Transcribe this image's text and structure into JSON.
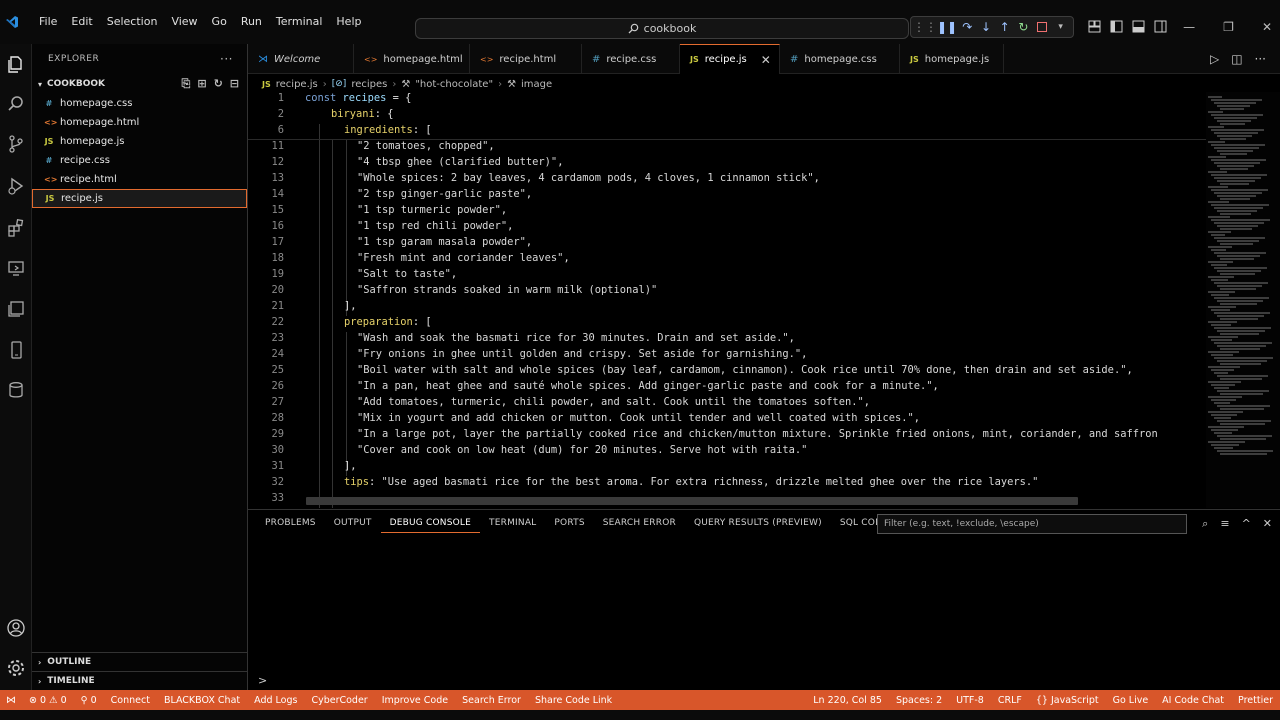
{
  "titlebar": {
    "menu": [
      "File",
      "Edit",
      "Selection",
      "View",
      "Go",
      "Run",
      "Terminal",
      "Help"
    ],
    "search_text": "cookbook"
  },
  "sidebar": {
    "header": "EXPLORER",
    "folder": "COOKBOOK",
    "files": [
      {
        "name": "homepage.css",
        "type": "css",
        "icon_text": "#"
      },
      {
        "name": "homepage.html",
        "type": "html",
        "icon_text": "<>"
      },
      {
        "name": "homepage.js",
        "type": "js",
        "icon_text": "JS"
      },
      {
        "name": "recipe.css",
        "type": "css",
        "icon_text": "#"
      },
      {
        "name": "recipe.html",
        "type": "html",
        "icon_text": "<>"
      },
      {
        "name": "recipe.js",
        "type": "js",
        "icon_text": "JS"
      }
    ],
    "outline": "OUTLINE",
    "timeline": "TIMELINE"
  },
  "tabs": [
    {
      "label": "Welcome",
      "type": "vscode"
    },
    {
      "label": "homepage.html",
      "type": "html"
    },
    {
      "label": "recipe.html",
      "type": "html"
    },
    {
      "label": "recipe.css",
      "type": "css"
    },
    {
      "label": "recipe.js",
      "type": "js"
    },
    {
      "label": "homepage.css",
      "type": "css"
    },
    {
      "label": "homepage.js",
      "type": "js"
    }
  ],
  "breadcrumb": [
    "recipe.js",
    "recipes",
    "\"hot-chocolate\"",
    "image"
  ],
  "code_lines": [
    {
      "n": "1",
      "indent": 0,
      "parts": [
        [
          "kw",
          "const "
        ],
        [
          "var",
          "recipes"
        ],
        [
          "punc",
          " = {"
        ]
      ]
    },
    {
      "n": "2",
      "indent": 1,
      "parts": [
        [
          "prop",
          "biryani"
        ],
        [
          "punc",
          ": {"
        ]
      ]
    },
    {
      "n": "6",
      "indent": 2,
      "parts": [
        [
          "prop",
          "ingredients"
        ],
        [
          "punc",
          ": ["
        ]
      ]
    },
    {
      "n": "11",
      "indent": 3,
      "parts": [
        [
          "str",
          "\"2 tomatoes, chopped\""
        ],
        [
          "punc",
          ","
        ]
      ]
    },
    {
      "n": "12",
      "indent": 3,
      "parts": [
        [
          "str",
          "\"4 tbsp ghee (clarified butter)\""
        ],
        [
          "punc",
          ","
        ]
      ]
    },
    {
      "n": "13",
      "indent": 3,
      "parts": [
        [
          "str",
          "\"Whole spices: 2 bay leaves, 4 cardamom pods, 4 cloves, 1 cinnamon stick\""
        ],
        [
          "punc",
          ","
        ]
      ]
    },
    {
      "n": "14",
      "indent": 3,
      "parts": [
        [
          "str",
          "\"2 tsp ginger-garlic paste\""
        ],
        [
          "punc",
          ","
        ]
      ]
    },
    {
      "n": "15",
      "indent": 3,
      "parts": [
        [
          "str",
          "\"1 tsp turmeric powder\""
        ],
        [
          "punc",
          ","
        ]
      ]
    },
    {
      "n": "16",
      "indent": 3,
      "parts": [
        [
          "str",
          "\"1 tsp red chili powder\""
        ],
        [
          "punc",
          ","
        ]
      ]
    },
    {
      "n": "17",
      "indent": 3,
      "parts": [
        [
          "str",
          "\"1 tsp garam masala powder\""
        ],
        [
          "punc",
          ","
        ]
      ]
    },
    {
      "n": "18",
      "indent": 3,
      "parts": [
        [
          "str",
          "\"Fresh mint and coriander leaves\""
        ],
        [
          "punc",
          ","
        ]
      ]
    },
    {
      "n": "19",
      "indent": 3,
      "parts": [
        [
          "str",
          "\"Salt to taste\""
        ],
        [
          "punc",
          ","
        ]
      ]
    },
    {
      "n": "20",
      "indent": 3,
      "parts": [
        [
          "str",
          "\"Saffron strands soaked in warm milk (optional)\""
        ]
      ]
    },
    {
      "n": "21",
      "indent": 2,
      "parts": [
        [
          "punc",
          "],"
        ]
      ]
    },
    {
      "n": "22",
      "indent": 2,
      "parts": [
        [
          "prop",
          "preparation"
        ],
        [
          "punc",
          ": ["
        ]
      ]
    },
    {
      "n": "23",
      "indent": 3,
      "parts": [
        [
          "str",
          "\"Wash and soak the basmati rice for 30 minutes. Drain and set aside.\""
        ],
        [
          "punc",
          ","
        ]
      ]
    },
    {
      "n": "24",
      "indent": 3,
      "parts": [
        [
          "str",
          "\"Fry onions in ghee until golden and crispy. Set aside for garnishing.\""
        ],
        [
          "punc",
          ","
        ]
      ]
    },
    {
      "n": "25",
      "indent": 3,
      "parts": [
        [
          "str",
          "\"Boil water with salt and whole spices (bay leaf, cardamom, cinnamon). Cook rice until 70% done, then drain and set aside.\""
        ],
        [
          "punc",
          ","
        ]
      ]
    },
    {
      "n": "26",
      "indent": 3,
      "parts": [
        [
          "str",
          "\"In a pan, heat ghee and sauté whole spices. Add ginger-garlic paste and cook for a minute.\""
        ],
        [
          "punc",
          ","
        ]
      ]
    },
    {
      "n": "27",
      "indent": 3,
      "parts": [
        [
          "str",
          "\"Add tomatoes, turmeric, chili powder, and salt. Cook until the tomatoes soften.\""
        ],
        [
          "punc",
          ","
        ]
      ]
    },
    {
      "n": "28",
      "indent": 3,
      "parts": [
        [
          "str",
          "\"Mix in yogurt and add chicken or mutton. Cook until tender and well coated with spices.\""
        ],
        [
          "punc",
          ","
        ]
      ]
    },
    {
      "n": "29",
      "indent": 3,
      "parts": [
        [
          "str",
          "\"In a large pot, layer the partially cooked rice and chicken/mutton mixture. Sprinkle fried onions, mint, coriander, and saffron"
        ]
      ]
    },
    {
      "n": "30",
      "indent": 3,
      "parts": [
        [
          "str",
          "\"Cover and cook on low heat (dum) for 20 minutes. Serve hot with raita.\""
        ]
      ]
    },
    {
      "n": "31",
      "indent": 2,
      "parts": [
        [
          "punc",
          "],"
        ]
      ]
    },
    {
      "n": "32",
      "indent": 2,
      "parts": [
        [
          "prop",
          "tips"
        ],
        [
          "punc",
          ": "
        ],
        [
          "str",
          "\"Use aged basmati rice for the best aroma. For extra richness, drizzle melted ghee over the rice layers.\""
        ]
      ]
    },
    {
      "n": "33",
      "indent": 2,
      "parts": []
    }
  ],
  "panel": {
    "tabs": [
      "PROBLEMS",
      "OUTPUT",
      "DEBUG CONSOLE",
      "TERMINAL",
      "PORTS",
      "SEARCH ERROR",
      "QUERY RESULTS (PREVIEW)",
      "SQL CONSOLE"
    ],
    "active_tab": "DEBUG CONSOLE",
    "filter_placeholder": "Filter (e.g. text, !exclude, \\escape)",
    "prompt": ">"
  },
  "statusbar": {
    "left": [
      "⊗ 0 ⚠ 0",
      "⚲ 0",
      "Connect",
      "BLACKBOX Chat",
      "Add Logs",
      "CyberCoder",
      "Improve Code",
      "Search Error",
      "Share Code Link"
    ],
    "right": [
      "Ln 220, Col 85",
      "Spaces: 2",
      "UTF-8",
      "CRLF",
      "{} JavaScript",
      "Go Live",
      "AI Code Chat",
      "Prettier"
    ]
  },
  "colors": {
    "accent": "#e36b2f",
    "statusbar": "#d8562a"
  }
}
